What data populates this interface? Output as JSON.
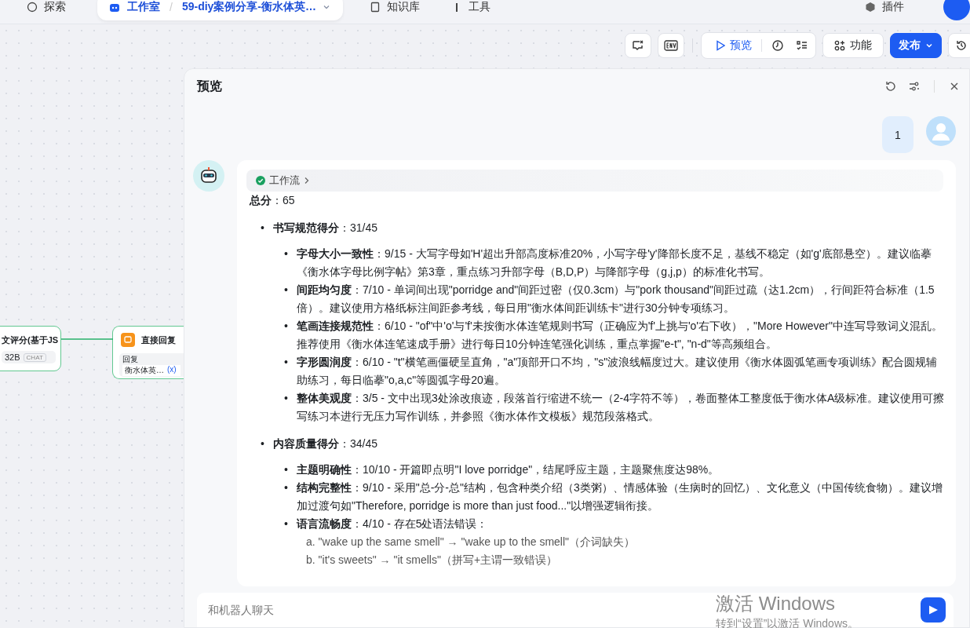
{
  "top_nav": {
    "items": [
      {
        "label": "探索",
        "kind": "explore",
        "selected": false
      },
      {
        "label": "工作室",
        "kind": "studio",
        "selected": true,
        "separator": "/",
        "breadcrumb": "59-diy案例分享-衡水体英…"
      },
      {
        "label": "知识库",
        "kind": "knowledge",
        "selected": false
      },
      {
        "label": "工具",
        "kind": "tools",
        "selected": false
      }
    ],
    "plugin": "插件"
  },
  "toolbar": {
    "preview": "预览",
    "features": "功能",
    "publish": "发布"
  },
  "canvas_nodes": [
    {
      "kind": "llm",
      "title": "文评分(基于JS",
      "meta": "32B",
      "tag": "CHAT"
    },
    {
      "kind": "reply",
      "title": "直接回复",
      "field_label": "回复",
      "value": "衡水体英…",
      "variable": "(x)"
    }
  ],
  "preview": {
    "title": "预览",
    "user_message": "1",
    "workflow_label": "工作流",
    "total": "**总分**：65",
    "sections": [
      {
        "marker": "•",
        "text": "**书写规范得分**：31/45",
        "items": [
          {
            "marker": "•",
            "text": "**字母大小一致性**：9/15 - 大写字母如'H'超出升部高度标准20%，小写字母'y'降部长度不足，基线不稳定（如'g'底部悬空）。建议临摹《衡水体字母比例字帖》第3章，重点练习升部字母（B,D,P）与降部字母（g,j,p）的标准化书写。"
          },
          {
            "marker": "•",
            "text": "**间距均匀度**：7/10 - 单词间出现\"porridge and\"间距过密（仅0.3cm）与\"pork thousand\"间距过疏（达1.2cm），行间距符合标准（1.5倍）。建议使用方格纸标注间距参考线，每日用\"衡水体间距训练卡\"进行30分钟专项练习。"
          },
          {
            "marker": "•",
            "text": "**笔画连接规范性**：6/10 - \"of\"中'o'与'f'未按衡水体连笔规则书写（正确应为'f'上挑与'o'右下收），\"More However\"中连写导致词义混乱。推荐使用《衡水体连笔速成手册》进行每日10分钟连笔强化训练，重点掌握\"e-t\", \"n-d\"等高频组合。"
          },
          {
            "marker": "•",
            "text": "**字形圆润度**：6/10 - \"t\"横笔画僵硬呈直角，\"a\"顶部开口不均，\"s\"波浪线幅度过大。建议使用《衡水体圆弧笔画专项训练》配合圆规辅助练习，每日临摹\"o,a,c\"等圆弧字母20遍。"
          },
          {
            "marker": "•",
            "text": "**整体美观度**：3/5 - 文中出现3处涂改痕迹，段落首行缩进不统一（2-4字符不等），卷面整体工整度低于衡水体A级标准。建议使用可擦写练习本进行无压力写作训练，并参照《衡水体作文模板》规范段落格式。"
          }
        ]
      },
      {
        "marker": "•",
        "text": "**内容质量得分**：34/45",
        "items": [
          {
            "marker": "•",
            "text": "**主题明确性**：10/10 - 开篇即点明\"I love porridge\"，结尾呼应主题，主题聚焦度达98%。"
          },
          {
            "marker": "•",
            "text": "**结构完整性**：9/10 - 采用\"总-分-总\"结构，包含种类介绍（3类粥）、情感体验（生病时的回忆）、文化意义（中国传统食物）。建议增加过渡句如\"Therefore, porridge is more than just food...\"以增强逻辑衔接。"
          },
          {
            "marker": "•",
            "text": "**语言流畅度**：4/10 - 存在5处语法错误：",
            "sublines": [
              "a. \"wake up the same smell\" → \"wake up to the smell\"（介词缺失）",
              "b. \"it's sweets\" → \"it smells\"（拼写+主谓一致错误）"
            ]
          }
        ]
      }
    ],
    "input_placeholder": "和机器人聊天"
  },
  "os_overlay": {
    "title": "激活 Windows",
    "subtitle": "转到“设置”以激活 Windows。"
  }
}
